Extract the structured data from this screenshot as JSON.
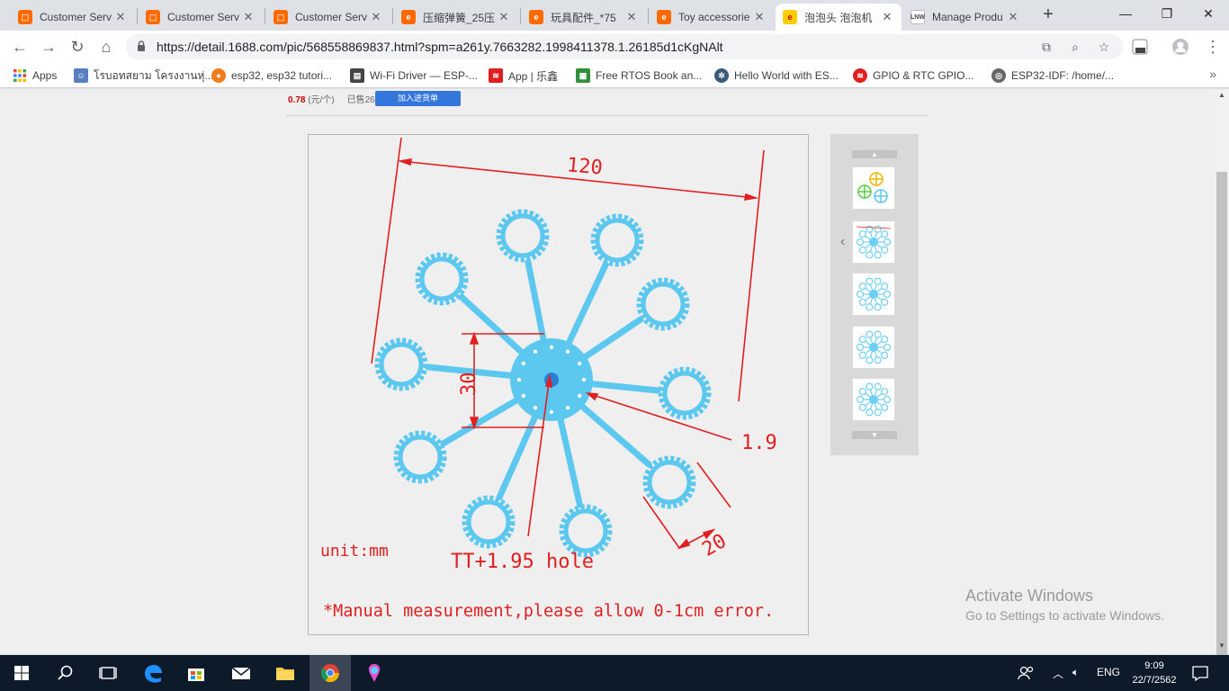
{
  "tabs": [
    {
      "title": "Customer Serv",
      "favicon": "alibaba-icon",
      "color": "#ff6a00"
    },
    {
      "title": "Customer Serv",
      "favicon": "alibaba-icon",
      "color": "#ff6a00"
    },
    {
      "title": "Customer Serv",
      "favicon": "alibaba-icon",
      "color": "#ff6a00"
    },
    {
      "title": "压缩弹簧_25压",
      "favicon": "1688-icon",
      "color": "#ff6a00"
    },
    {
      "title": "玩具配件_*75",
      "favicon": "1688-icon",
      "color": "#ff6a00"
    },
    {
      "title": "Toy accessorie",
      "favicon": "1688-icon",
      "color": "#ff6a00"
    },
    {
      "title": "泡泡头 泡泡机",
      "favicon": "1688-active-icon",
      "color": "#ffcc00"
    },
    {
      "title": "Manage Produ",
      "favicon": "lnw-icon",
      "color": "#444444"
    }
  ],
  "address": {
    "url": "https://detail.1688.com/pic/568558869837.html?spm=a261y.7663282.1998411378.1.26185d1cKgNAlt"
  },
  "bookmarks": [
    {
      "label": "Apps",
      "icon": "apps-grid-icon"
    },
    {
      "label": "โรบอทสยาม โครงงานหุ่...",
      "icon": "robot-icon"
    },
    {
      "label": "esp32, esp32 tutori...",
      "icon": "esp-icon"
    },
    {
      "label": "Wi-Fi Driver — ESP-...",
      "icon": "doc-icon"
    },
    {
      "label": "App | 乐鑫",
      "icon": "espressif-icon"
    },
    {
      "label": "Free RTOS Book an...",
      "icon": "rtos-icon"
    },
    {
      "label": "Hello World with ES...",
      "icon": "gear-icon"
    },
    {
      "label": "GPIO & RTC GPIO...",
      "icon": "espressif-icon"
    },
    {
      "label": "ESP32-IDF: /home/...",
      "icon": "globe-icon"
    }
  ],
  "product": {
    "price": "0.78",
    "price_unit": "(元/个)",
    "sold": "已售2609个",
    "add_button": "加入进货单"
  },
  "image_labels": {
    "dim_120": "120",
    "dim_30": "30",
    "dim_19": "1.9",
    "dim_20": "20",
    "unit": "unit:mm",
    "hole": "TT+1.95 hole",
    "note": "*Manual measurement,please allow 0-1cm error."
  },
  "watermark": {
    "title": "Activate Windows",
    "subtitle": "Go to Settings to activate Windows."
  },
  "taskbar": {
    "lang": "ENG",
    "time": "9:09",
    "date": "22/7/2562"
  },
  "colors": {
    "part_blue": "#5cc8ef",
    "dim_red": "#e02020",
    "accent": "#3377dd"
  }
}
